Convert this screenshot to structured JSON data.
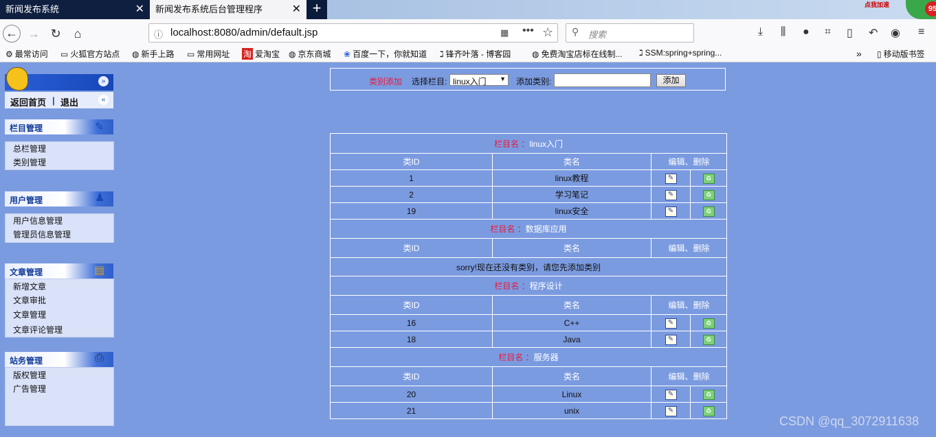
{
  "browser": {
    "tabs": [
      {
        "title": "新闻发布系统"
      },
      {
        "title": "新闻发布系统后台管理程序"
      }
    ],
    "badge_label": "点我加速",
    "badge_count": "95",
    "url": "localhost:8080/admin/default.jsp",
    "search_placeholder": "搜索",
    "bookmarks": [
      {
        "label": "最常访问",
        "icon": "gear-icon"
      },
      {
        "label": "火狐官方站点",
        "icon": "folder-icon"
      },
      {
        "label": "新手上路",
        "icon": "globe-icon"
      },
      {
        "label": "常用网址",
        "icon": "folder-icon"
      },
      {
        "label": "爱淘宝",
        "icon": "taobao-icon"
      },
      {
        "label": "京东商城",
        "icon": "globe-icon"
      },
      {
        "label": "百度一下，你就知道",
        "icon": "baidu-icon"
      },
      {
        "label": "锋齐叶落 - 博客园",
        "icon": "blog-icon"
      },
      {
        "label": "免费淘宝店标在线制...",
        "icon": "globe-icon"
      },
      {
        "label": "SSM:spring+spring...",
        "icon": "blog-icon"
      }
    ],
    "mobile_bookmarks": "移动版书签"
  },
  "sidebar": {
    "top_links": {
      "home": "返回首页",
      "separator": "|",
      "logout": "退出"
    },
    "panels": [
      {
        "title": "栏目管理",
        "items": [
          "总栏管理",
          "类别管理"
        ]
      },
      {
        "title": "用户管理",
        "items": [
          "用户信息管理",
          "管理员信息管理"
        ]
      },
      {
        "title": "文章管理",
        "items": [
          "新增文章",
          "文章审批",
          "文章管理",
          "文章评论管理"
        ]
      },
      {
        "title": "站务管理",
        "items": [
          "版权管理",
          "广告管理"
        ]
      }
    ]
  },
  "form": {
    "title": "类别添加",
    "select_label": "选择栏目:",
    "select_value": "linux入门",
    "add_label": "添加类别:",
    "add_value": "",
    "submit": "添加"
  },
  "table": {
    "column_prefix": "栏目名 ：",
    "headers": {
      "id": "类ID",
      "name": "类名",
      "ops": "编辑、删除"
    },
    "empty_message": "sorry!现在还没有类别，请您先添加类别",
    "sections": [
      {
        "name": "linux入门",
        "rows": [
          {
            "id": "1",
            "name": "linux教程"
          },
          {
            "id": "2",
            "name": "学习笔记"
          },
          {
            "id": "19",
            "name": "linux安全"
          }
        ]
      },
      {
        "name": "数据库应用",
        "rows": []
      },
      {
        "name": "程序设计",
        "rows": [
          {
            "id": "16",
            "name": "C++"
          },
          {
            "id": "18",
            "name": "Java"
          }
        ]
      },
      {
        "name": "服务器",
        "rows": [
          {
            "id": "20",
            "name": "Linux"
          },
          {
            "id": "21",
            "name": "unix"
          }
        ]
      }
    ]
  },
  "watermark": "CSDN @qq_3072911638"
}
